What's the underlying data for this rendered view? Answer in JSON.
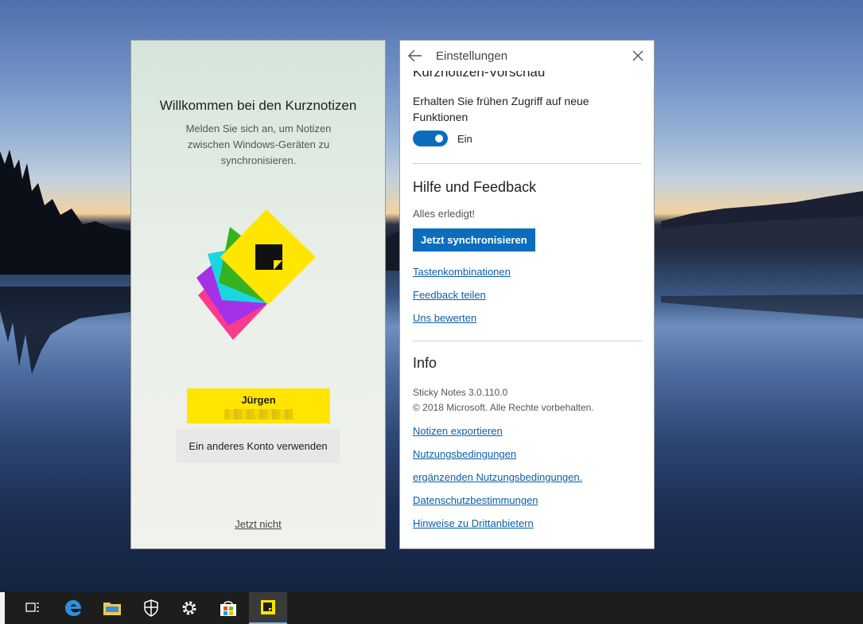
{
  "welcome": {
    "title": "Willkommen bei den Kurznotizen",
    "subtitle": "Melden Sie sich an, um Notizen zwischen Windows-Geräten zu synchronisieren.",
    "account_name": "Jürgen",
    "other_account": "Ein anderes Konto verwenden",
    "not_now": "Jetzt nicht"
  },
  "settings": {
    "title": "Einstellungen",
    "preview_heading": "Kurznotizen-Vorschau",
    "preview_desc": "Erhalten Sie frühen Zugriff auf neue Funktionen",
    "toggle_label": "Ein",
    "help_heading": "Hilfe und Feedback",
    "sync_status": "Alles erledigt!",
    "sync_button": "Jetzt synchronisieren",
    "help_links": [
      "Tastenkombinationen",
      "Feedback teilen",
      "Uns bewerten"
    ],
    "info_heading": "Info",
    "version": "Sticky Notes 3.0.110.0",
    "copyright": "© 2018 Microsoft. Alle Rechte vorbehalten.",
    "info_links": [
      "Notizen exportieren",
      "Nutzungsbedingungen",
      "ergänzenden Nutzungsbedingungen.",
      "Datenschutzbestimmungen",
      "Hinweise zu Drittanbietern"
    ]
  },
  "taskbar": {
    "icons": [
      "task-view-icon",
      "edge-icon",
      "file-explorer-icon",
      "security-icon",
      "settings-gear-icon",
      "store-icon",
      "sticky-notes-icon"
    ]
  },
  "colors": {
    "accent": "#0a6ebd",
    "account_button": "#ffe500",
    "link": "#0a5fa8"
  }
}
